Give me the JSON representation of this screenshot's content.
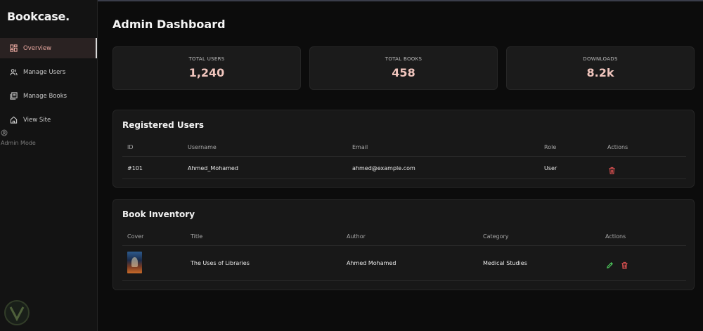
{
  "sidebar": {
    "brand": "Bookcase.",
    "items": [
      {
        "label": "Overview",
        "icon": "dashboard-icon",
        "active": true
      },
      {
        "label": "Manage Users",
        "icon": "users-icon",
        "active": false
      },
      {
        "label": "Manage Books",
        "icon": "books-icon",
        "active": false
      },
      {
        "label": "View Site",
        "icon": "home-icon",
        "active": false
      }
    ],
    "admin_mode": "Admin Mode"
  },
  "header": {
    "title": "Admin Dashboard"
  },
  "stats": [
    {
      "label": "TOTAL USERS",
      "value": "1,240"
    },
    {
      "label": "TOTAL BOOKS",
      "value": "458"
    },
    {
      "label": "DOWNLOADS",
      "value": "8.2k"
    }
  ],
  "users_panel": {
    "title": "Registered Users",
    "columns": [
      "ID",
      "Username",
      "Email",
      "Role",
      "Actions"
    ],
    "rows": [
      {
        "id": "#101",
        "username": "Ahmed_Mohamed",
        "email": "ahmed@example.com",
        "role": "User"
      }
    ]
  },
  "books_panel": {
    "title": "Book Inventory",
    "columns": [
      "Cover",
      "Title",
      "Author",
      "Category",
      "Actions"
    ],
    "rows": [
      {
        "title": "The Uses of Libraries",
        "author": "Ahmed Mohamed",
        "category": "Medical Studies"
      }
    ]
  },
  "colors": {
    "accent": "#e7a79f",
    "stat_value": "#f0c5bd",
    "delete": "#e05252",
    "edit": "#4cc35a"
  }
}
